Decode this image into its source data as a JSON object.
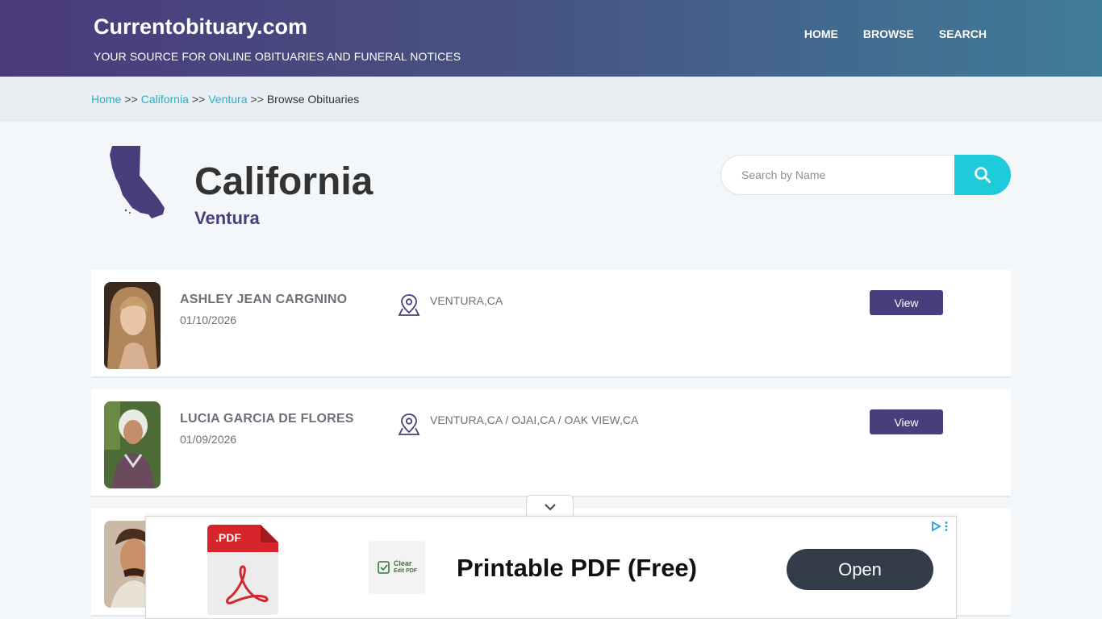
{
  "header": {
    "logo": "Currentobituary.com",
    "tagline": "YOUR SOURCE FOR ONLINE OBITUARIES AND FUNERAL NOTICES",
    "nav": [
      {
        "label": "HOME"
      },
      {
        "label": "BROWSE"
      },
      {
        "label": "SEARCH"
      }
    ]
  },
  "breadcrumb": {
    "items": [
      {
        "label": "Home"
      },
      {
        "label": "California"
      },
      {
        "label": "Ventura"
      }
    ],
    "separator": ">>",
    "current": "Browse Obituaries"
  },
  "page": {
    "title": "California",
    "subtitle": "Ventura"
  },
  "search": {
    "placeholder": "Search by Name"
  },
  "obituaries": [
    {
      "name": "ASHLEY JEAN CARGNINO",
      "date": "01/10/2026",
      "location": "VENTURA,CA",
      "button": "View"
    },
    {
      "name": "LUCIA GARCIA DE FLORES",
      "date": "01/09/2026",
      "location": "VENTURA,CA / OJAI,CA / OAK VIEW,CA",
      "button": "View"
    },
    {
      "name": "",
      "date": "",
      "location": "",
      "button": ""
    }
  ],
  "ad": {
    "file_badge": ".PDF",
    "brand_line1": "Clear",
    "brand_line2": "Edit PDF",
    "headline": "Printable PDF (Free)",
    "cta": "Open"
  },
  "colors": {
    "accent_purple": "#4a3d7b",
    "link_teal": "#2eaec0",
    "search_button": "#1fcadb",
    "ad_button": "#333d49"
  }
}
